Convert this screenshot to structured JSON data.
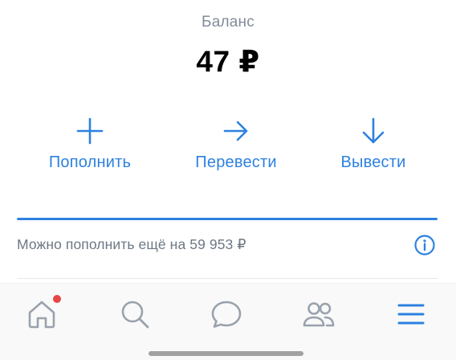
{
  "balance": {
    "label": "Баланс",
    "amount": "47 ₽"
  },
  "actions": [
    {
      "label": "Пополнить",
      "icon": "plus-icon"
    },
    {
      "label": "Перевести",
      "icon": "arrow-right-icon"
    },
    {
      "label": "Вывести",
      "icon": "arrow-down-icon"
    }
  ],
  "limit": {
    "text": "Можно пополнить ещё на 59 953 ₽",
    "progress_fraction": 1.0,
    "info_icon": "info-icon"
  },
  "tabbar": {
    "items": [
      {
        "name": "home",
        "icon": "home-icon",
        "has_notification": true
      },
      {
        "name": "search",
        "icon": "search-icon"
      },
      {
        "name": "messages",
        "icon": "chat-bubble-icon"
      },
      {
        "name": "friends",
        "icon": "friends-icon"
      },
      {
        "name": "menu",
        "icon": "hamburger-menu-icon"
      }
    ]
  },
  "colors": {
    "accent": "#2d81e0",
    "icon_gray": "#99a2ad",
    "notification": "#e64646",
    "secondary_text": "#6d7885"
  }
}
